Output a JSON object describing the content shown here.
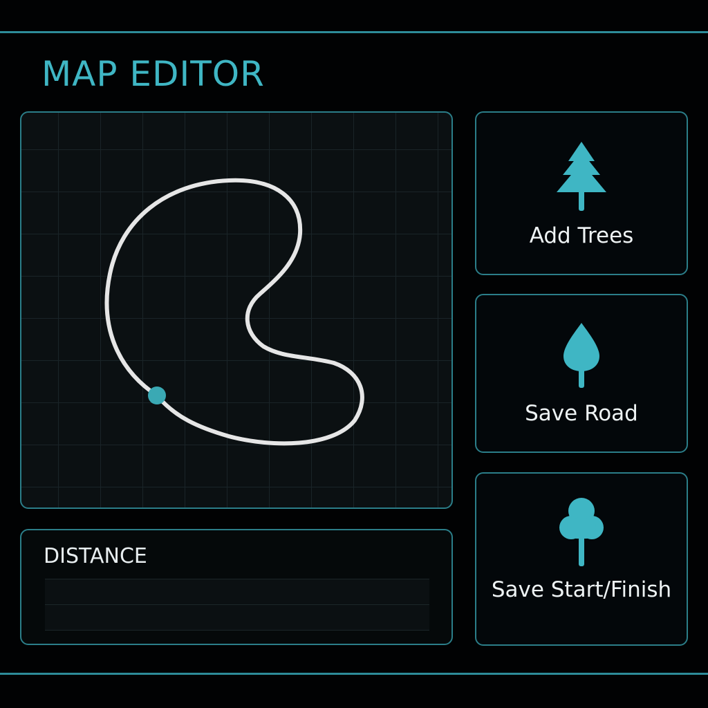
{
  "app": {
    "title": "MAP EDITOR"
  },
  "colors": {
    "accent": "#3fb6c4",
    "border": "#2b7e89",
    "road": "#e6e6e6",
    "start_marker": "#3aa9b4",
    "background": "#010203"
  },
  "map": {
    "road_style": "closed loop track",
    "start_point_marker": "start-finish-dot"
  },
  "distance": {
    "label": "DISTANCE",
    "values": [
      "",
      ""
    ]
  },
  "tools": [
    {
      "label": "Add Trees",
      "icon": "pine-tree-icon"
    },
    {
      "label": "Save Road",
      "icon": "leaf-tree-icon"
    },
    {
      "label": "Save Start/Finish",
      "icon": "round-tree-icon"
    }
  ]
}
